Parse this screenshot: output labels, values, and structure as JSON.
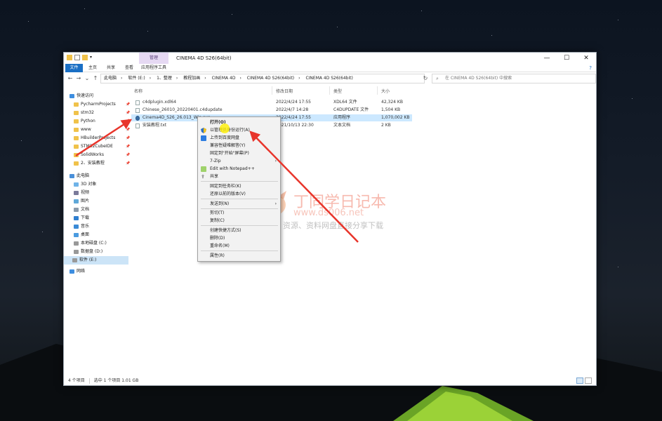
{
  "window": {
    "title": "CINEMA 4D S26(64bit)",
    "context_tab_group": "管理",
    "controls": [
      "—",
      "☐",
      "✕"
    ]
  },
  "ribbon": {
    "tabs": [
      "文件",
      "主页",
      "共享",
      "查看",
      "应用程序工具"
    ]
  },
  "address": {
    "path": [
      "此电脑",
      "软件 (E:)",
      "1、整理",
      "教程加画",
      "CINEMA 4D",
      "CINEMA 4D S26(64bit)",
      "CINEMA 4D S26(64bit)"
    ],
    "search_placeholder": "在 CINEMA 4D S26(64bit) 中搜索"
  },
  "sidebar": {
    "items": [
      {
        "label": "快速访问",
        "icon": "star-icon",
        "pinned": false
      },
      {
        "label": "PycharmProjects",
        "icon": "folder-icon",
        "pinned": true
      },
      {
        "label": "stm32",
        "icon": "folder-icon",
        "pinned": true
      },
      {
        "label": "Python",
        "icon": "folder-icon",
        "pinned": true
      },
      {
        "label": "www",
        "icon": "folder-icon",
        "pinned": true
      },
      {
        "label": "HBuilderProjects",
        "icon": "folder-icon",
        "pinned": true
      },
      {
        "label": "STM32CubeIDE",
        "icon": "folder-icon",
        "pinned": true
      },
      {
        "label": "SolidWorks",
        "icon": "folder-icon",
        "pinned": true
      },
      {
        "label": "2、安装教程",
        "icon": "folder-icon",
        "pinned": true
      },
      {
        "label": "此电脑",
        "icon": "computer-icon",
        "pinned": false
      },
      {
        "label": "3D 对象",
        "icon": "cube-icon",
        "pinned": false
      },
      {
        "label": "视频",
        "icon": "video-icon",
        "pinned": false
      },
      {
        "label": "图片",
        "icon": "picture-icon",
        "pinned": false
      },
      {
        "label": "文档",
        "icon": "document-icon",
        "pinned": false
      },
      {
        "label": "下载",
        "icon": "download-icon",
        "pinned": false
      },
      {
        "label": "音乐",
        "icon": "music-icon",
        "pinned": false
      },
      {
        "label": "桌面",
        "icon": "desktop-icon",
        "pinned": false
      },
      {
        "label": "本地磁盘 (C:)",
        "icon": "drive-icon",
        "pinned": false
      },
      {
        "label": "数据盘 (D:)",
        "icon": "drive-icon",
        "pinned": false
      },
      {
        "label": "软件 (E:)",
        "icon": "drive-icon",
        "pinned": false
      },
      {
        "label": "网络",
        "icon": "network-icon",
        "pinned": false
      }
    ]
  },
  "files": {
    "headers": [
      "名称",
      "修改日期",
      "类型",
      "大小"
    ],
    "rows": [
      {
        "name": "c4dplugin.xdl64",
        "date": "2022/4/24 17:55",
        "type": "XDL64 文件",
        "size": "42,324 KB",
        "icon": "file-icon"
      },
      {
        "name": "Chinese_26010_20220401.c4dupdate",
        "date": "2022/4/7 14:28",
        "type": "C4DUPDATE 文件",
        "size": "1,504 KB",
        "icon": "file-icon"
      },
      {
        "name": "Cinema4D_S26_26.013_Win.exe",
        "date": "2022/4/24 17:55",
        "type": "应用程序",
        "size": "1,070,002 KB",
        "icon": "setup-icon"
      },
      {
        "name": "安装教程.txt",
        "date": "2021/10/13 22:30",
        "type": "文本文档",
        "size": "2 KB",
        "icon": "text-file-icon"
      }
    ]
  },
  "context_menu": {
    "items": [
      {
        "label": "打开(O)",
        "bold": true,
        "icon": "",
        "submenu": false
      },
      {
        "label": "以管理员身份运行(A)",
        "bold": false,
        "icon": "shield-icon",
        "submenu": false
      },
      {
        "label": "上传到百度网盘",
        "bold": false,
        "icon": "cloud-icon",
        "submenu": false
      },
      {
        "label": "兼容性疑难解答(Y)",
        "bold": false,
        "icon": "",
        "submenu": false
      },
      {
        "label": "固定到\"开始\"屏幕(P)",
        "bold": false,
        "icon": "",
        "submenu": false
      },
      {
        "label": "7-Zip",
        "bold": false,
        "icon": "",
        "submenu": true
      },
      {
        "label": "Edit with Notepad++",
        "bold": false,
        "icon": "notepad-icon",
        "submenu": false
      },
      {
        "label": "共享",
        "bold": false,
        "icon": "share-icon",
        "submenu": false
      },
      {
        "label": "固定到任务栏(K)",
        "bold": false,
        "icon": "",
        "submenu": false
      },
      {
        "label": "还原以前的版本(V)",
        "bold": false,
        "icon": "",
        "submenu": false
      },
      {
        "label": "发送到(N)",
        "bold": false,
        "icon": "",
        "submenu": true
      },
      {
        "label": "剪切(T)",
        "bold": false,
        "icon": "",
        "submenu": false
      },
      {
        "label": "复制(C)",
        "bold": false,
        "icon": "",
        "submenu": false
      },
      {
        "label": "创建快捷方式(S)",
        "bold": false,
        "icon": "",
        "submenu": false
      },
      {
        "label": "删除(D)",
        "bold": false,
        "icon": "",
        "submenu": false
      },
      {
        "label": "重命名(M)",
        "bold": false,
        "icon": "",
        "submenu": false
      },
      {
        "label": "属性(R)",
        "bold": false,
        "icon": "",
        "submenu": false
      }
    ]
  },
  "status": {
    "count": "4 个项目",
    "selection": "选中 1 个项目  1.01 GB"
  },
  "watermark": {
    "title": "丁同学日记本",
    "url": "www.ds006.net",
    "slogan": "软件、资源、资料网盘直接分享下载"
  },
  "colors": {
    "accent": "#1a6fc4",
    "selection": "#cce8ff",
    "annotation_arrow": "#e8352b"
  }
}
